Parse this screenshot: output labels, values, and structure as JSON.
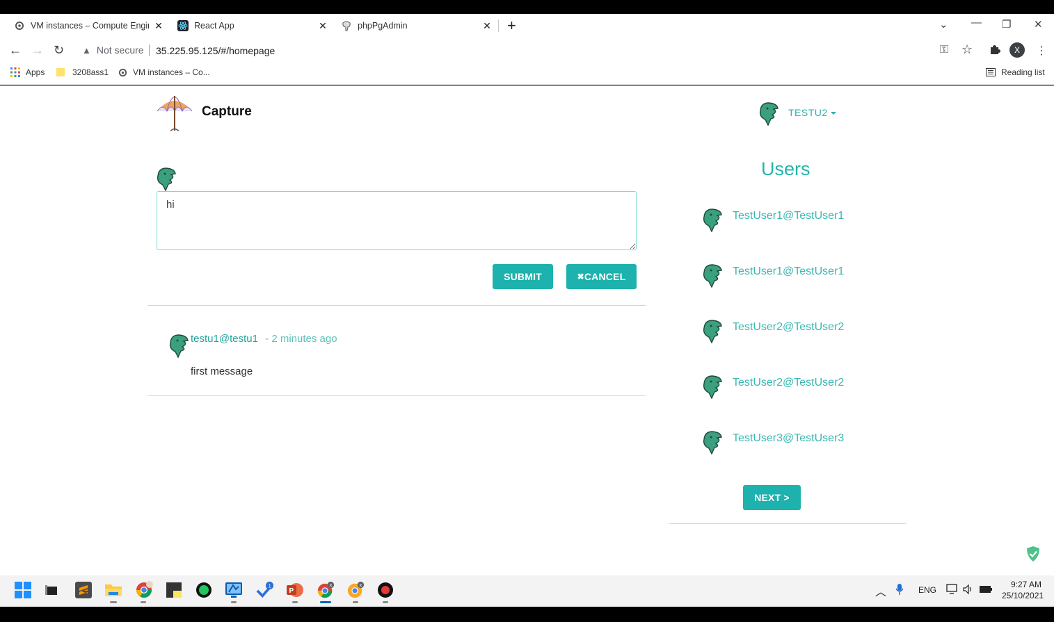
{
  "browser": {
    "tabs": [
      {
        "title": "VM instances – Compute Engine"
      },
      {
        "title": "React App"
      },
      {
        "title": "phpPgAdmin"
      }
    ],
    "security_label": "Not secure",
    "url": "35.225.95.125/#/homepage",
    "bookmarks": [
      {
        "label": "Apps"
      },
      {
        "label": "3208ass1"
      },
      {
        "label": "VM instances – Co..."
      }
    ],
    "reading_list": "Reading list",
    "profile_initial": "X"
  },
  "header": {
    "brand": "Capture",
    "current_user": "TESTU2"
  },
  "composer": {
    "value": "hi",
    "submit_label": "SUBMIT",
    "cancel_label": "CANCEL",
    "cancel_icon": "✖"
  },
  "feed": [
    {
      "author": "testu1@testu1",
      "time": " - 2 minutes ago",
      "body": "first message"
    }
  ],
  "users_panel": {
    "title": "Users",
    "users": [
      "TestUser1@TestUser1",
      "TestUser1@TestUser1",
      "TestUser2@TestUser2",
      "TestUser2@TestUser2",
      "TestUser3@TestUser3"
    ],
    "next_label": "NEXT >"
  },
  "taskbar": {
    "language": "ENG",
    "time": "9:27 AM",
    "date": "25/10/2021"
  },
  "colors": {
    "accent": "#1db2ad",
    "link": "#39b7b0",
    "avatar": "#3aa07f"
  }
}
